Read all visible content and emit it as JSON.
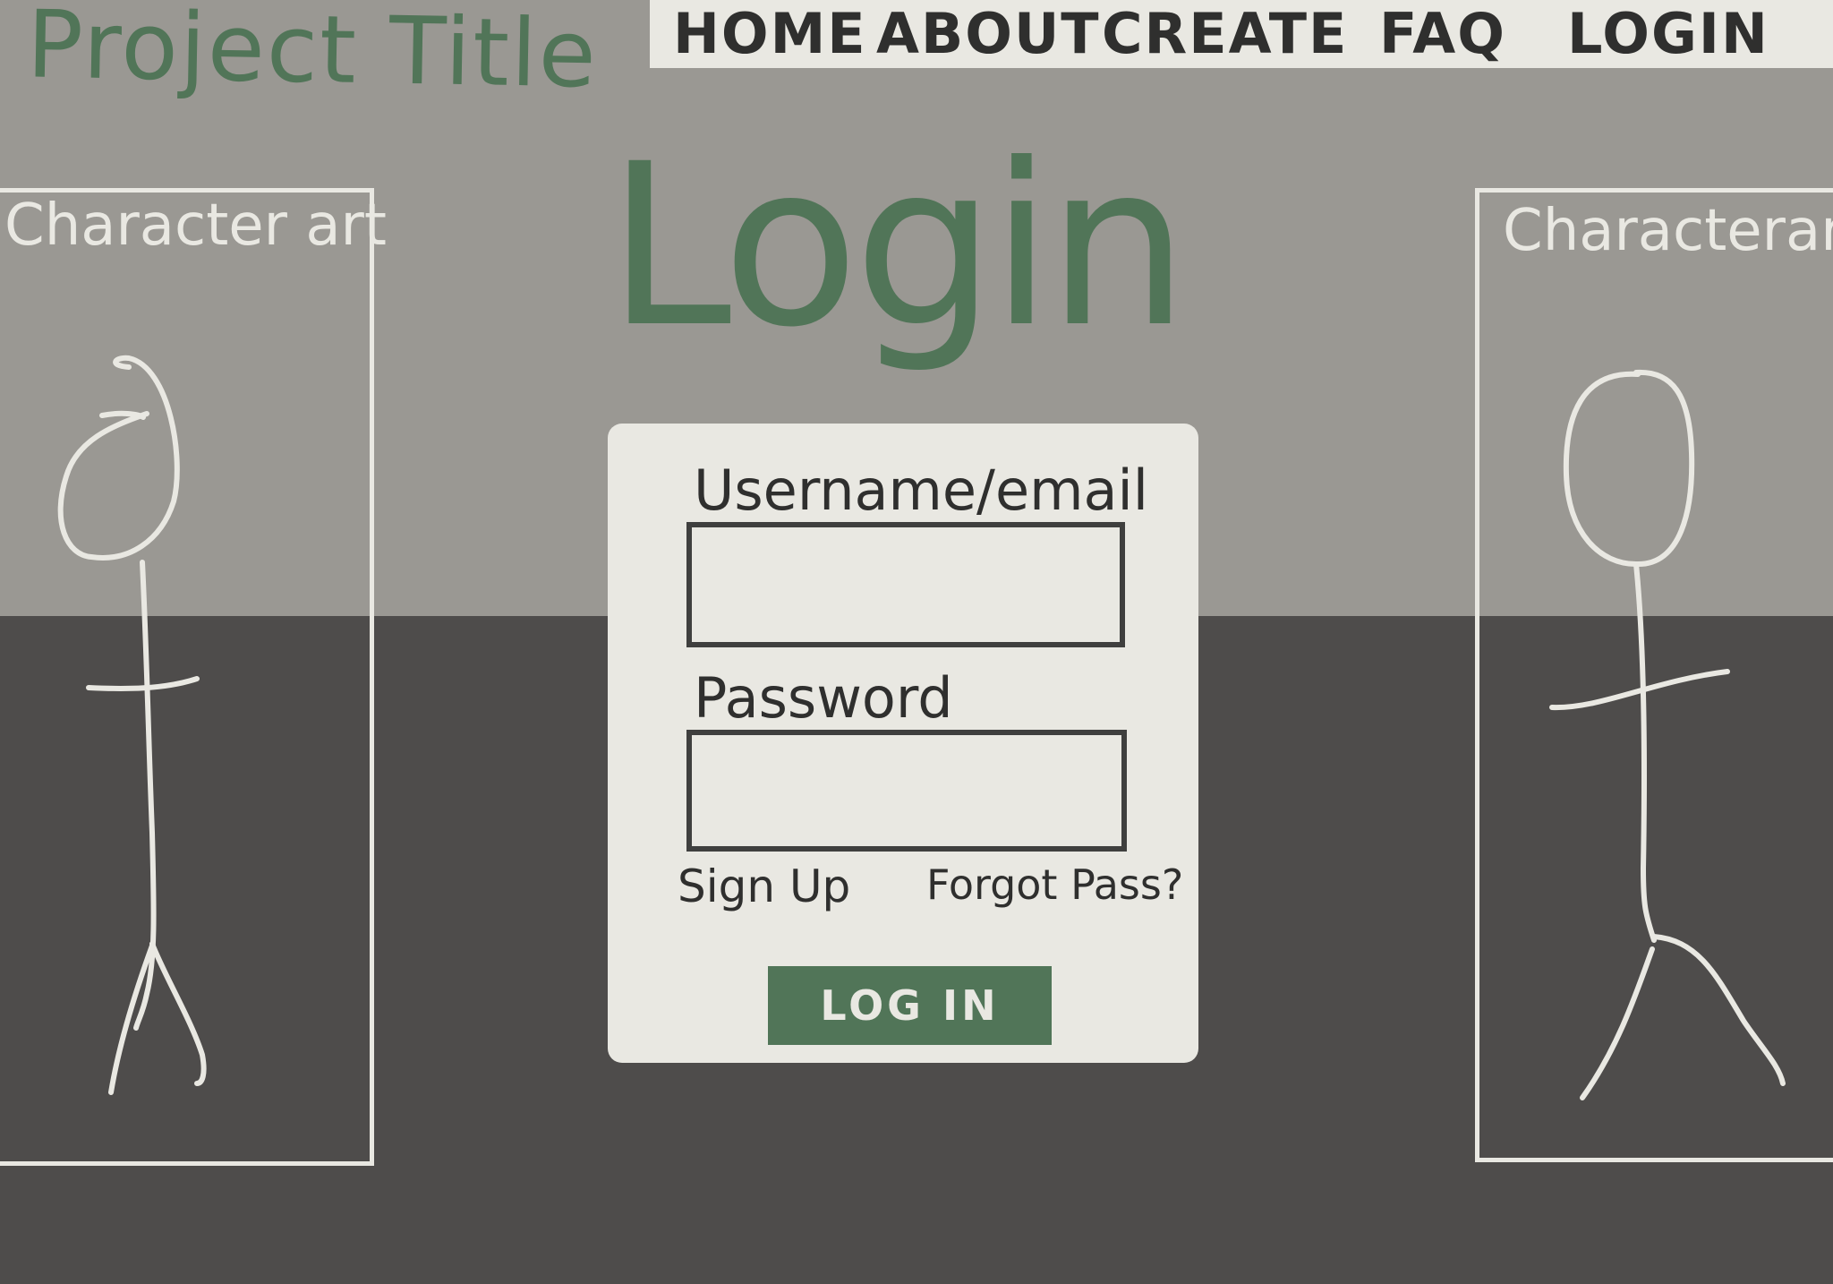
{
  "header": {
    "project_title": "Project Title",
    "nav": [
      {
        "label": "HOME"
      },
      {
        "label": "ABOUT"
      },
      {
        "label": "CREATE"
      },
      {
        "label": "FAQ"
      },
      {
        "label": "LOGIN"
      }
    ]
  },
  "main": {
    "heading": "Login",
    "left_panel": {
      "label": "Character art"
    },
    "right_panel": {
      "label": "Characterart"
    },
    "form": {
      "username_label": "Username/email",
      "username_value": "",
      "password_label": "Password",
      "password_value": "",
      "sign_up_link": "Sign Up",
      "forgot_link": "Forgot Pass?",
      "submit_label": "LOG IN"
    }
  },
  "colors": {
    "accent_green": "#517558",
    "top_background": "#9a9893",
    "bottom_background": "#4e4c4b",
    "card_background": "#e9e8e2",
    "sketch_white": "#e9e8e2"
  }
}
